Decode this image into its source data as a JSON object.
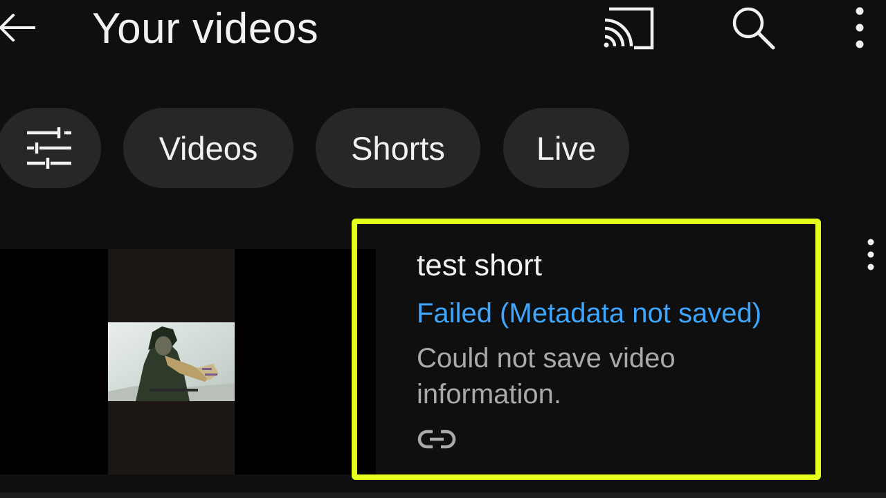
{
  "topbar": {
    "title": "Your videos",
    "icons": {
      "back": "arrow-left-icon",
      "cast": "cast-icon",
      "search": "search-icon",
      "more": "more-vert-icon"
    }
  },
  "filters": {
    "filter_icon": "tune-icon",
    "chips": [
      {
        "label": "Videos"
      },
      {
        "label": "Shorts"
      },
      {
        "label": "Live"
      }
    ]
  },
  "video": {
    "title": "test short",
    "status": "Failed (Metadata not saved)",
    "error_message": "Could not save video information.",
    "link_icon": "link-icon",
    "more_icon": "more-vert-icon"
  },
  "colors": {
    "background": "#0f0f0f",
    "chip_bg": "#272727",
    "text_primary": "#f1f1f1",
    "text_secondary": "#aaaaaa",
    "status_blue": "#3ea6ff",
    "highlight": "#e5ff1c"
  }
}
